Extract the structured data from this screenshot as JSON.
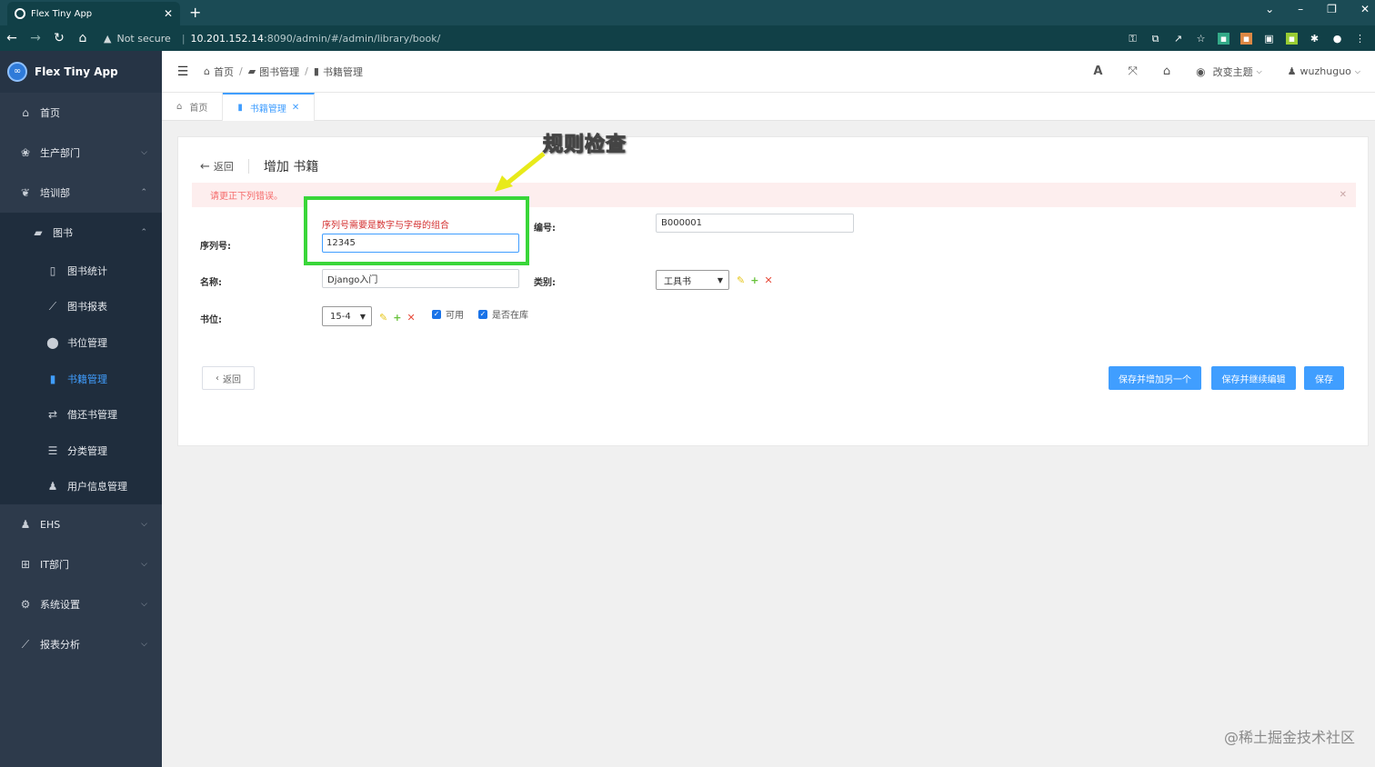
{
  "browser": {
    "tab_title": "Flex Tiny App",
    "url_warning": "Not secure",
    "url_host": "10.201.152.14",
    "url_path": ":8090/admin/#/admin/library/book/"
  },
  "sidebar": {
    "brand": "Flex Tiny App",
    "items": [
      {
        "label": "首页",
        "icon": "home-icon"
      },
      {
        "label": "生产部门",
        "icon": "paw-icon"
      },
      {
        "label": "培训部",
        "icon": "leaf-icon"
      },
      {
        "label": "图书",
        "icon": "book-open-icon"
      },
      {
        "label": "图书统计",
        "icon": "blank-icon"
      },
      {
        "label": "图书报表",
        "icon": "chart-line-icon"
      },
      {
        "label": "书位管理",
        "icon": "map-pin-icon"
      },
      {
        "label": "书籍管理",
        "icon": "book-icon"
      },
      {
        "label": "借还书管理",
        "icon": "exchange-icon"
      },
      {
        "label": "分类管理",
        "icon": "list-icon"
      },
      {
        "label": "用户信息管理",
        "icon": "user-icon"
      },
      {
        "label": "EHS",
        "icon": "users-icon"
      },
      {
        "label": "IT部门",
        "icon": "windows-icon"
      },
      {
        "label": "系统设置",
        "icon": "gear-icon"
      },
      {
        "label": "报表分析",
        "icon": "chart-area-icon"
      }
    ]
  },
  "header": {
    "breadcrumbs": [
      "首页",
      "图书管理",
      "书籍管理"
    ],
    "theme_label": "改变主题",
    "user": "wuzhuguo"
  },
  "page_tabs": [
    {
      "label": "首页"
    },
    {
      "label": "书籍管理"
    }
  ],
  "form": {
    "back_label": "返回",
    "title": "增加 书籍",
    "error_summary": "请更正下列错误。",
    "serial_label": "序列号:",
    "serial_error": "序列号需要是数字与字母的组合",
    "serial_value": "12345",
    "code_label": "编号:",
    "code_value": "B000001",
    "name_label": "名称:",
    "name_value": "Django入门",
    "category_label": "类别:",
    "category_value": "工具书",
    "location_label": "书位:",
    "location_value": "15-4",
    "available_label": "可用",
    "in_stock_label": "是否在库"
  },
  "buttons": {
    "back": "返回",
    "save_add_another": "保存并增加另一个",
    "save_continue": "保存并继续编辑",
    "save": "保存"
  },
  "annotation": "规则检查",
  "watermark": "@稀土掘金技术社区"
}
